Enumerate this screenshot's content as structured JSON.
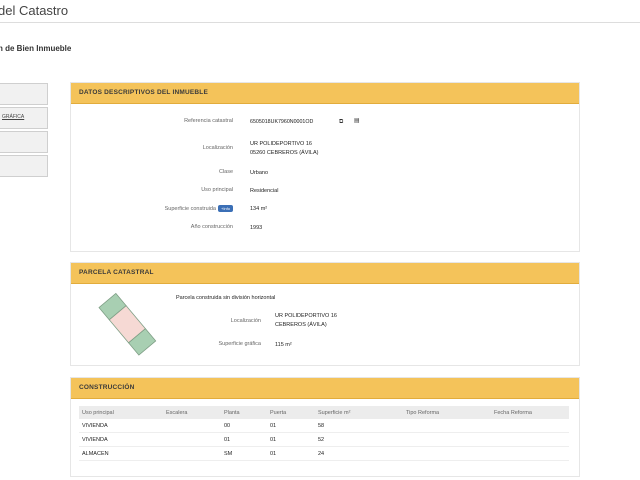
{
  "site": {
    "title": "del Catastro"
  },
  "page": {
    "heading": "n de Bien Inmueble"
  },
  "side_menu": {
    "items": [
      {
        "label": ""
      },
      {
        "label": "GRÁFICA"
      },
      {
        "label": ""
      },
      {
        "label": ""
      }
    ]
  },
  "descriptivos": {
    "header": "DATOS DESCRIPTIVOS DEL INMUEBLE",
    "rows": {
      "ref_label": "Referencia catastral",
      "ref_value": "6505018UK7960N0001OD",
      "loc_label": "Localización",
      "loc_line1": "UR POLIDEPORTIVO 16",
      "loc_line2": "05260 CEBREROS (ÁVILA)",
      "clase_label": "Clase",
      "clase_value": "Urbano",
      "uso_label": "Uso principal",
      "uso_value": "Residencial",
      "sup_label": "Superficie construida",
      "sup_badge": "+Info",
      "sup_value": "134 m²",
      "anio_label": "Año construcción",
      "anio_value": "1993"
    },
    "icons": [
      "copy-icon",
      "barcode-icon"
    ]
  },
  "parcela": {
    "header": "PARCELA CATASTRAL",
    "description": "Parcela construida sin división horizontal",
    "loc_label": "Localización",
    "loc_line1": "UR POLIDEPORTIVO 16",
    "loc_line2": "CEBREROS (ÁVILA)",
    "sup_label": "Superficie gráfica",
    "sup_value": "115 m²",
    "colors": {
      "green": "#a8cfb2",
      "pink": "#f6d9d4",
      "stroke": "#7f9f86"
    }
  },
  "construccion": {
    "header": "CONSTRUCCIÓN",
    "columns": [
      "Uso principal",
      "Escalera",
      "Planta",
      "Puerta",
      "Superficie m²",
      "Tipo Reforma",
      "Fecha Reforma"
    ],
    "rows": [
      [
        "VIVIENDA",
        "",
        "00",
        "01",
        "58",
        "",
        ""
      ],
      [
        "VIVIENDA",
        "",
        "01",
        "01",
        "52",
        "",
        ""
      ],
      [
        "ALMACEN",
        "",
        "SM",
        "01",
        "24",
        "",
        ""
      ]
    ]
  },
  "colors": {
    "accent": "#f4c35a",
    "badge": "#3b6fb6"
  }
}
